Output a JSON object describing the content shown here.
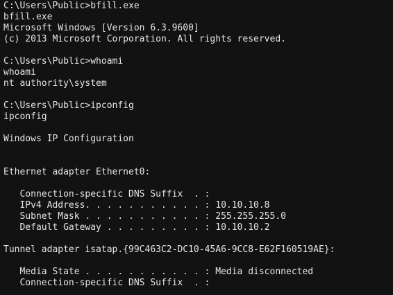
{
  "terminal": {
    "lines": [
      "C:\\Users\\Public>bfill.exe",
      "bfill.exe",
      "Microsoft Windows [Version 6.3.9600]",
      "(c) 2013 Microsoft Corporation. All rights reserved.",
      "",
      "C:\\Users\\Public>whoami",
      "whoami",
      "nt authority\\system",
      "",
      "C:\\Users\\Public>ipconfig",
      "ipconfig",
      "",
      "Windows IP Configuration",
      "",
      "",
      "Ethernet adapter Ethernet0:",
      "",
      "   Connection-specific DNS Suffix  . :",
      "   IPv4 Address. . . . . . . . . . . : 10.10.10.8",
      "   Subnet Mask . . . . . . . . . . . : 255.255.255.0",
      "   Default Gateway . . . . . . . . . : 10.10.10.2",
      "",
      "Tunnel adapter isatap.{99C463C2-DC10-45A6-9CC8-E62F160519AE}:",
      "",
      "   Media State . . . . . . . . . . . : Media disconnected",
      "   Connection-specific DNS Suffix  . :"
    ]
  }
}
